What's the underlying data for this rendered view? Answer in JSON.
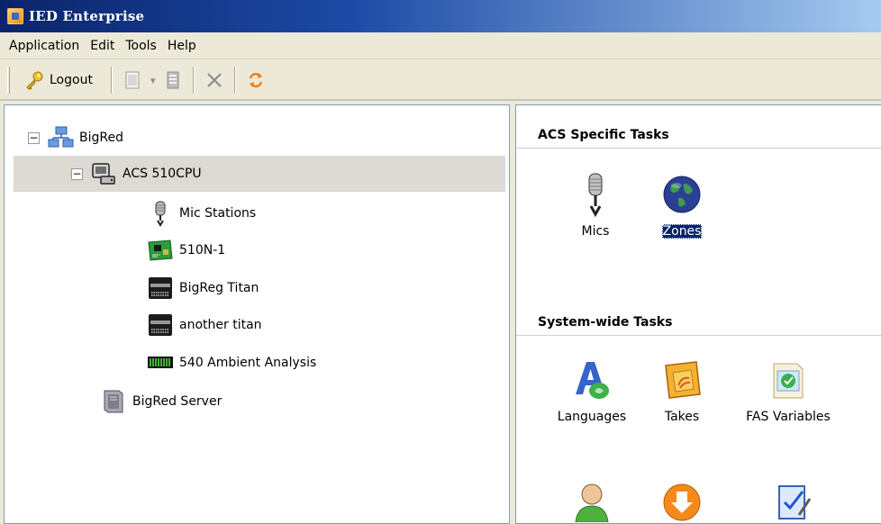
{
  "window": {
    "title": "IED Enterprise"
  },
  "menubar": {
    "items": [
      "Application",
      "Edit",
      "Tools",
      "Help"
    ]
  },
  "toolbar": {
    "logout_label": "Logout"
  },
  "tree": {
    "root": {
      "label": "BigRed",
      "expander": "−"
    },
    "cpu": {
      "label": "ACS 510CPU",
      "expander": "−"
    },
    "children": [
      {
        "label": "Mic Stations"
      },
      {
        "label": "510N-1"
      },
      {
        "label": "BigReg Titan"
      },
      {
        "label": "another titan"
      },
      {
        "label": "540 Ambient Analysis"
      }
    ],
    "server": {
      "label": "BigRed Server"
    }
  },
  "tasks": {
    "acs_header": "ACS Specific Tasks",
    "acs_items": [
      {
        "label": "Mics",
        "icon": "microphone-icon",
        "selected": false
      },
      {
        "label": "Zones",
        "icon": "globe-icon",
        "selected": true
      }
    ],
    "system_header": "System-wide Tasks",
    "system_items": [
      {
        "label": "Languages",
        "icon": "languages-icon"
      },
      {
        "label": "Takes",
        "icon": "takes-icon"
      },
      {
        "label": "FAS Variables",
        "icon": "fas-variables-icon"
      }
    ],
    "system_items_row2": [
      {
        "icon": "user-icon"
      },
      {
        "icon": "download-arrow-icon"
      },
      {
        "icon": "checklist-icon"
      }
    ]
  }
}
